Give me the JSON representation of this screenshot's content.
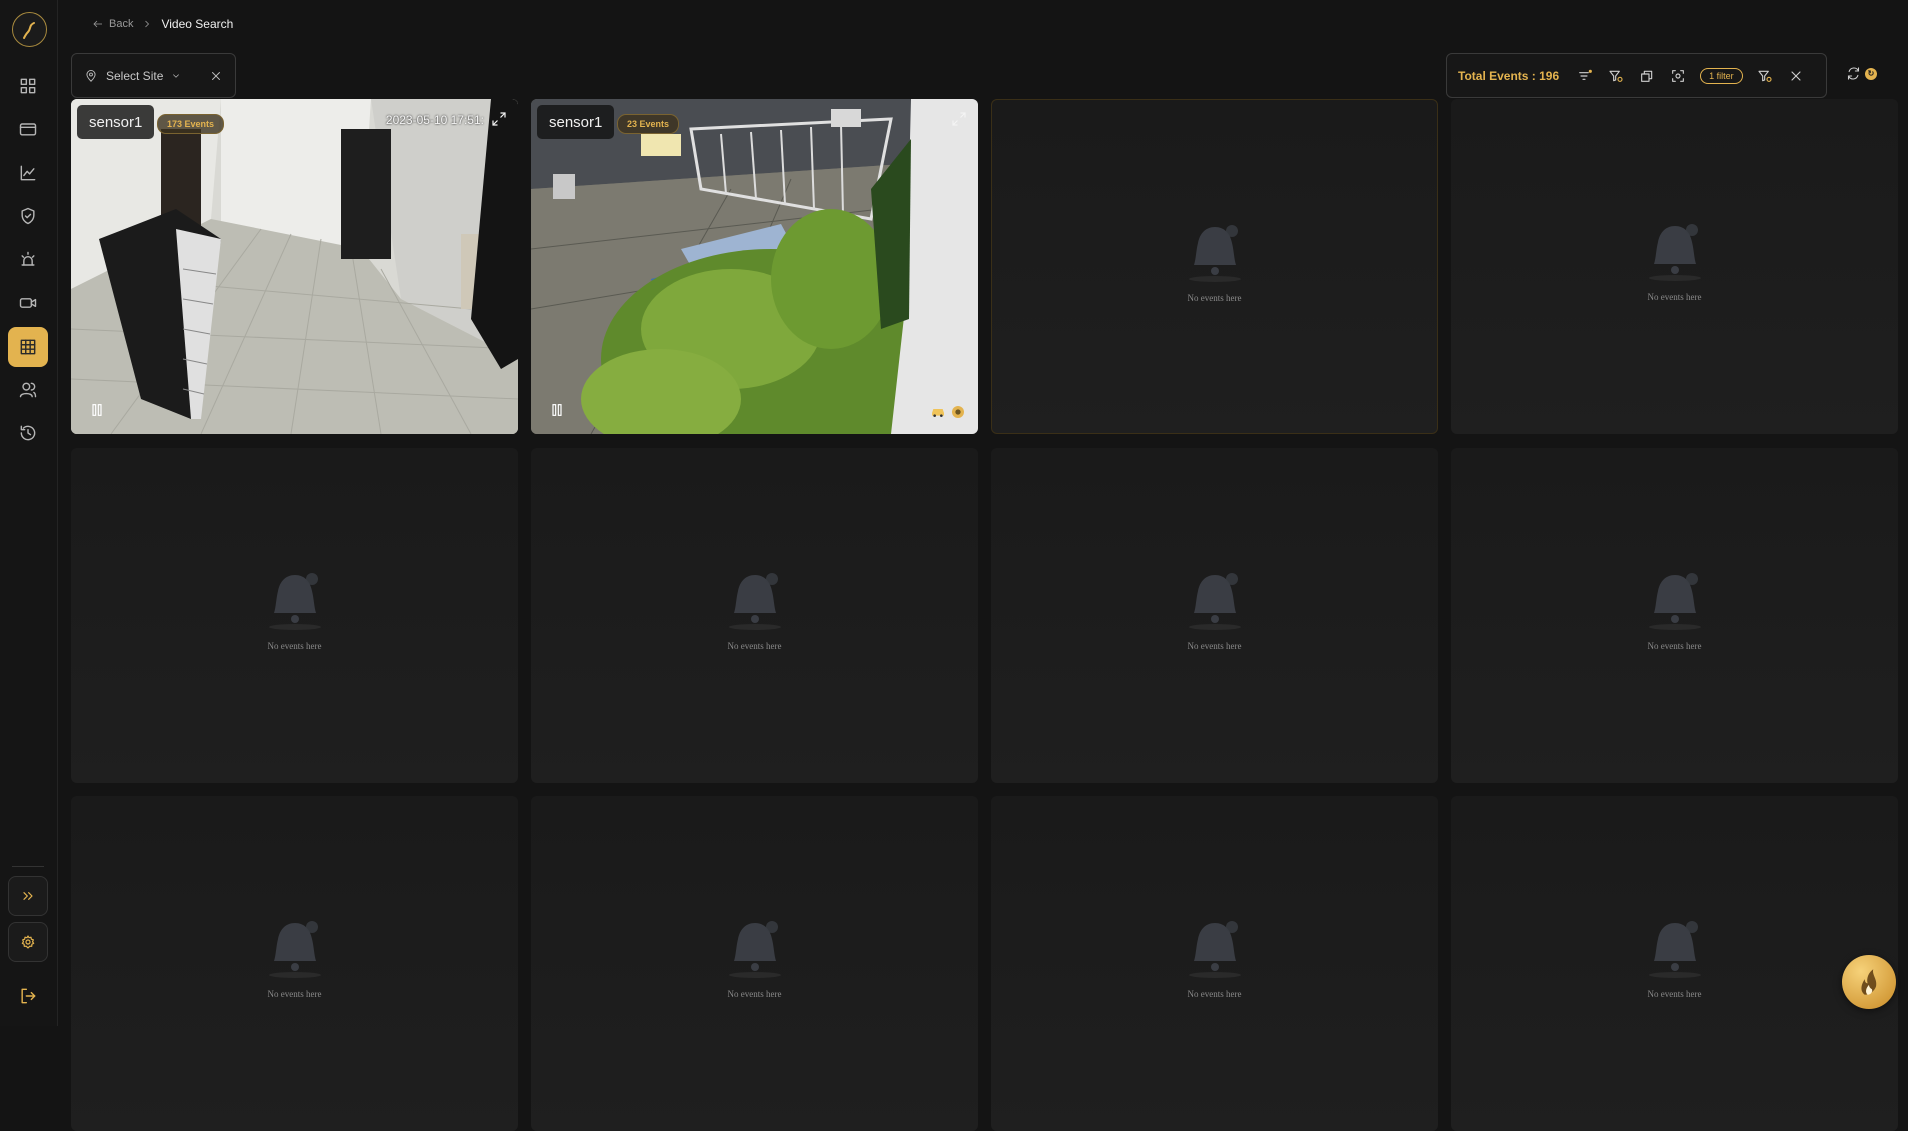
{
  "breadcrumb": {
    "back_label": "Back",
    "current": "Video Search"
  },
  "site_select": {
    "placeholder": "Select Site"
  },
  "toolbar": {
    "total_events": "Total Events : 196",
    "filter_count": "1 filter"
  },
  "sidebar": {
    "items": [
      {
        "icon": "dashboard-icon"
      },
      {
        "icon": "card-icon"
      },
      {
        "icon": "chart-icon"
      },
      {
        "icon": "shield-icon"
      },
      {
        "icon": "alarm-icon"
      },
      {
        "icon": "video-camera-icon"
      },
      {
        "icon": "grid-icon",
        "active": true
      },
      {
        "icon": "users-icon"
      },
      {
        "icon": "history-icon"
      }
    ]
  },
  "cameras": [
    {
      "name": "sensor1",
      "events": "173 Events",
      "timestamp": "2023-05-10 17:51:"
    },
    {
      "name": "sensor1",
      "events": "23 Events"
    }
  ],
  "empty_tiles": [
    {
      "text": "No events here"
    },
    {
      "text": "No events here"
    },
    {
      "text": "No events here"
    },
    {
      "text": "No events here"
    },
    {
      "text": "No events here"
    },
    {
      "text": "No events here"
    },
    {
      "text": "No events here"
    },
    {
      "text": "No events here"
    },
    {
      "text": "No events here"
    },
    {
      "text": "No events here"
    }
  ],
  "colors": {
    "accent": "#e3b34f",
    "background": "#141414"
  }
}
